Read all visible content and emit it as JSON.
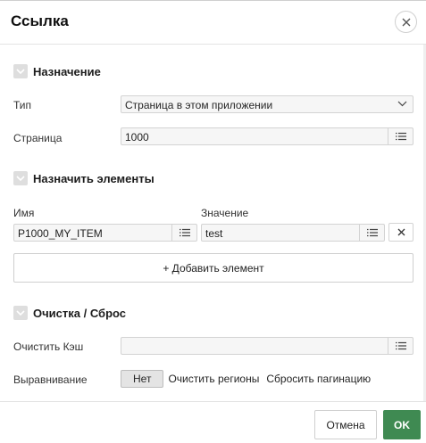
{
  "dialog": {
    "title": "Ссылка"
  },
  "sections": {
    "target": {
      "title": "Назначение"
    },
    "set_items": {
      "title": "Назначить элементы"
    },
    "clear_reset": {
      "title": "Очистка / Сброс"
    }
  },
  "target": {
    "type_label": "Тип",
    "type_value": "Страница в этом приложении",
    "page_label": "Страница",
    "page_value": "1000"
  },
  "items": {
    "name_header": "Имя",
    "value_header": "Значение",
    "rows": [
      {
        "name": "P1000_MY_ITEM",
        "value": "test"
      }
    ],
    "add_label": "+ Добавить элемент"
  },
  "clear": {
    "cache_label": "Очистить Кэш",
    "cache_value": "",
    "action_label": "Выравнивание",
    "options": [
      "Нет",
      "Очистить регионы",
      "Сбросить пагинацию"
    ],
    "selected": "Нет"
  },
  "footer": {
    "cancel_label": "Отмена",
    "ok_label": "OK"
  },
  "colors": {
    "ok_button": "#3f8a52",
    "field_background": "#f6f6f6"
  },
  "icons": {
    "close": "close-icon",
    "section_toggle": "chevron-down-icon",
    "list": "list-icon",
    "remove": "x-icon"
  }
}
